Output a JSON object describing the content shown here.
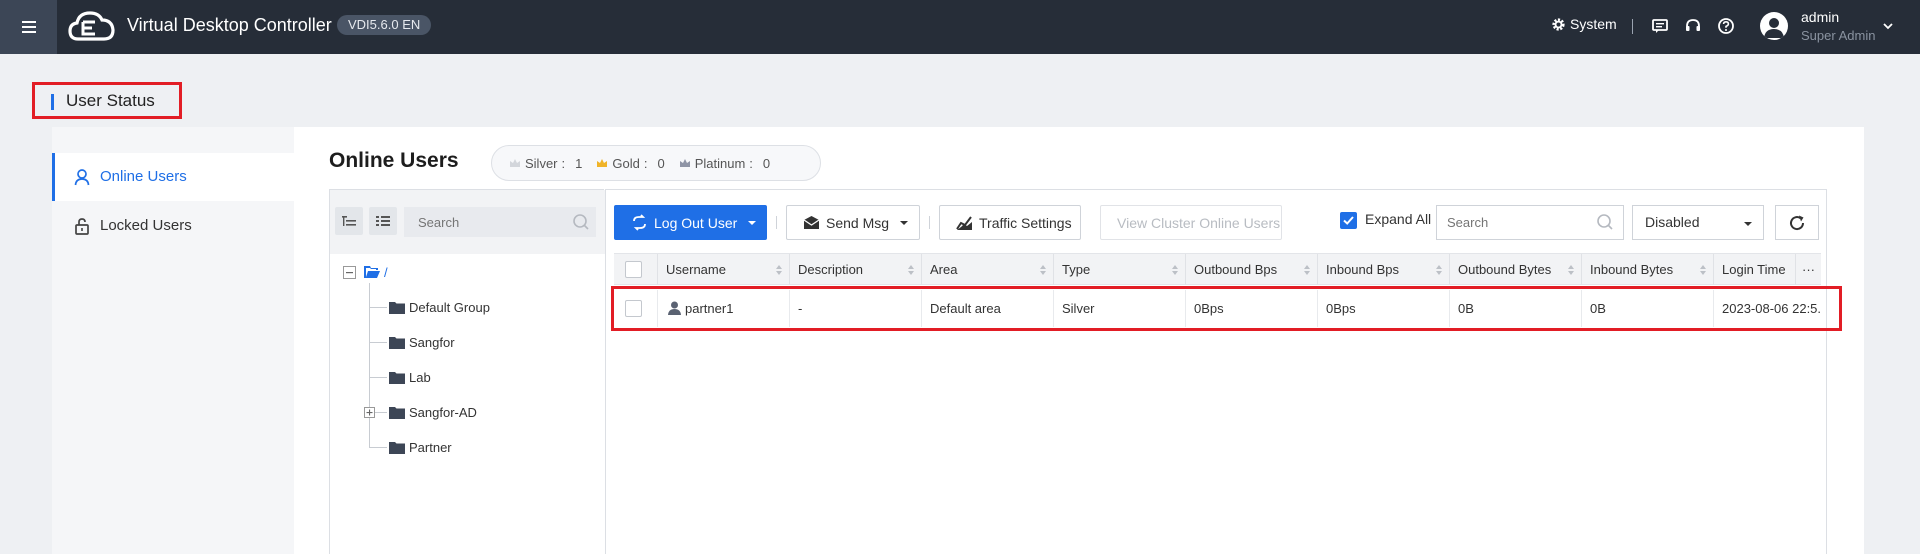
{
  "header": {
    "app_title": "Virtual Desktop Controller",
    "version": "VDI5.6.0 EN",
    "system_label": "System",
    "user_name": "admin",
    "user_role": "Super Admin"
  },
  "page": {
    "heading": "User Status"
  },
  "nav": {
    "items": [
      {
        "label": "Online Users",
        "icon": "user-icon",
        "active": true
      },
      {
        "label": "Locked Users",
        "icon": "lock-icon",
        "active": false
      }
    ]
  },
  "main": {
    "title": "Online Users",
    "levels": [
      {
        "label": "Silver",
        "value": "1"
      },
      {
        "label": "Gold",
        "value": "0"
      },
      {
        "label": "Platinum",
        "value": "0"
      }
    ]
  },
  "tree": {
    "search_placeholder": "Search",
    "root": "/",
    "nodes": [
      {
        "label": "Default Group",
        "expandable": false
      },
      {
        "label": "Sangfor",
        "expandable": false
      },
      {
        "label": "Lab",
        "expandable": false
      },
      {
        "label": "Sangfor-AD",
        "expandable": true
      },
      {
        "label": "Partner",
        "expandable": false
      }
    ]
  },
  "toolbar": {
    "logout_label": "Log Out User",
    "send_msg_label": "Send Msg",
    "traffic_label": "Traffic Settings",
    "cluster_label": "View Cluster Online Users",
    "expand_all_label": "Expand All",
    "expand_all_checked": true,
    "search_placeholder": "Search",
    "status_select": "Disabled"
  },
  "table": {
    "columns": [
      "Username",
      "Description",
      "Area",
      "Type",
      "Outbound Bps",
      "Inbound Bps",
      "Outbound Bytes",
      "Inbound Bytes",
      "Login Time"
    ],
    "more_label": "···",
    "rows": [
      {
        "username": "partner1",
        "description": "-",
        "area": "Default area",
        "type": "Silver",
        "outbound_bps": "0Bps",
        "inbound_bps": "0Bps",
        "outbound_bytes": "0B",
        "inbound_bytes": "0B",
        "login_time": "2023-08-06 22:5..."
      }
    ]
  },
  "colors": {
    "accent": "#1f6fe6",
    "topbar": "#262d38",
    "highlight": "#e21d25"
  }
}
